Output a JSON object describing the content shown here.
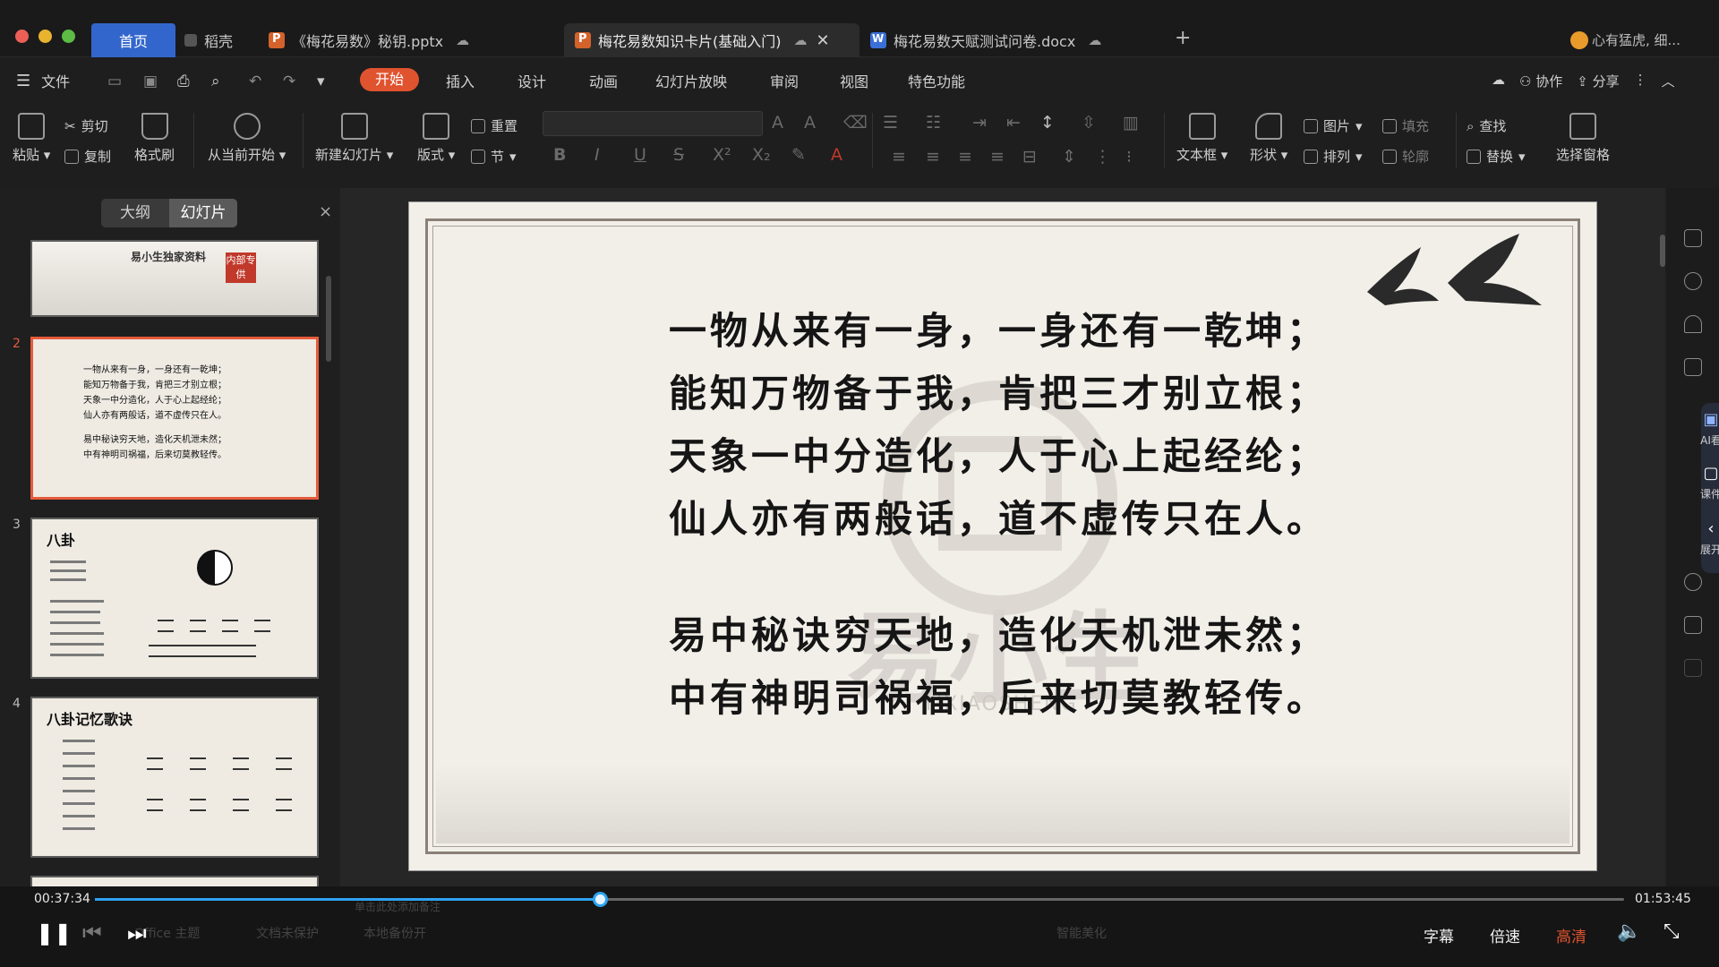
{
  "tabs": {
    "home": "首页",
    "daoke": "稻壳",
    "pptx1": "《梅花易数》秘钥.pptx",
    "pptx2": "梅花易数知识卡片(基础入门)",
    "docx": "梅花易数天赋测试问卷.docx",
    "add": "+",
    "user": "心有猛虎, 细..."
  },
  "menu": {
    "file": "文件",
    "start": "开始",
    "insert": "插入",
    "design": "设计",
    "animation": "动画",
    "slideshow": "幻灯片放映",
    "review": "审阅",
    "view": "视图",
    "special": "特色功能",
    "collab": "协作",
    "share": "分享"
  },
  "ribbon": {
    "paste": "粘贴",
    "cut": "剪切",
    "copy": "复制",
    "format_painter": "格式刷",
    "from_current": "从当前开始",
    "new_slide": "新建幻灯片",
    "layout": "版式",
    "reset": "重置",
    "section": "节",
    "textbox": "文本框",
    "shape": "形状",
    "picture": "图片",
    "arrange": "排列",
    "fill": "填充",
    "outline": "轮廓",
    "find": "查找",
    "replace": "替换",
    "select_pane": "选择窗格"
  },
  "panel": {
    "tab_outline": "大纲",
    "tab_slides": "幻灯片",
    "close": "×",
    "thumbs": [
      {
        "num": "",
        "title": "易小生独家资料",
        "stamp": "内部专供"
      },
      {
        "num": "2",
        "lines": [
          "一物从来有一身，一身还有一乾坤；",
          "能知万物备于我，肯把三才别立根；",
          "天象一中分造化，人于心上起经纶；",
          "仙人亦有两般话，道不虚传只在人。",
          "易中秘诀穷天地，造化天机泄未然；",
          "中有神明司祸福，后来切莫教轻传。"
        ]
      },
      {
        "num": "3",
        "title": "八卦"
      },
      {
        "num": "4",
        "title": "八卦记忆歌诀"
      }
    ]
  },
  "slide": {
    "poem": [
      "一物从来有一身，一身还有一乾坤；",
      "能知万物备于我，肯把三才别立根；",
      "天象一中分造化，人于心上起经纶；",
      "仙人亦有两般话，道不虚传只在人。",
      "易中秘诀穷天地，造化天机泄未然；",
      "中有神明司祸福，后来切莫教轻传。"
    ],
    "watermark_big": "易小生",
    "watermark_small": "YIXIAOSHENG"
  },
  "side_panel": {
    "ai_look": "AI看",
    "courseware": "课件",
    "expand": "展开"
  },
  "player": {
    "current_time": "00:37:34",
    "total_time": "01:53:45",
    "progress_fraction": 0.33,
    "subtitle": "字幕",
    "speed": "倍速",
    "quality": "高清",
    "ghost_left": "Office 主题",
    "ghost_mid": "文档未保护",
    "ghost_mid2": "本地备份开",
    "ghost_right": "智能美化",
    "ghost_note": "单击此处添加备注"
  },
  "colors": {
    "accent": "#e0532f",
    "home_tab": "#3366cc",
    "progress": "#2ea3f2"
  }
}
